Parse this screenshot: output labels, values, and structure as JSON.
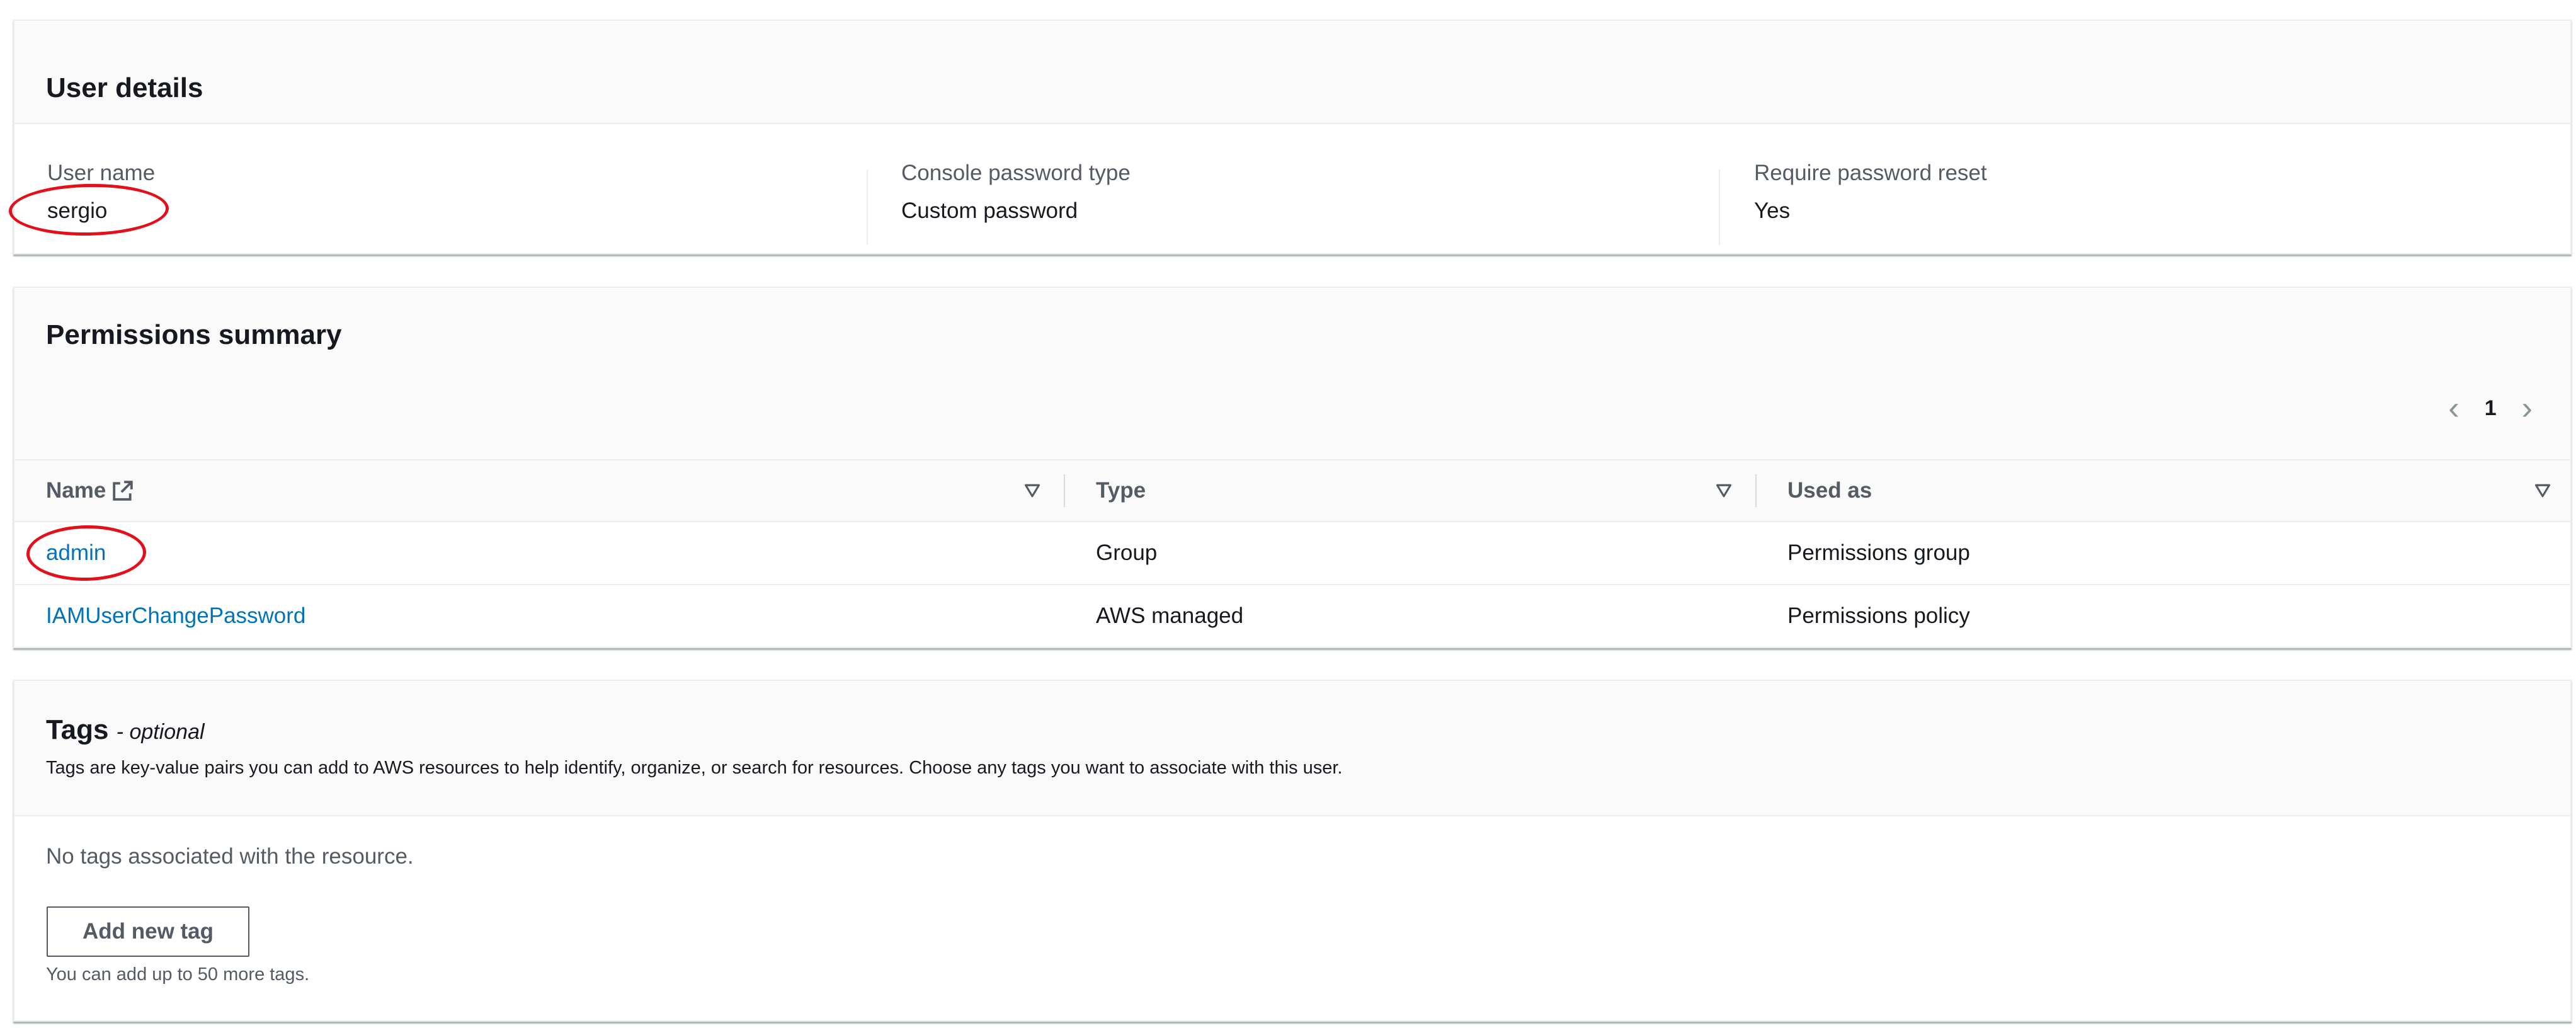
{
  "user_details": {
    "title": "User details",
    "fields": [
      {
        "label": "User name",
        "value": "sergio"
      },
      {
        "label": "Console password type",
        "value": "Custom password"
      },
      {
        "label": "Require password reset",
        "value": "Yes"
      }
    ]
  },
  "permissions": {
    "title": "Permissions summary",
    "pagination": {
      "current_page": "1"
    },
    "columns": [
      "Name",
      "Type",
      "Used as"
    ],
    "rows": [
      {
        "name": "admin",
        "type": "Group",
        "used_as": "Permissions group"
      },
      {
        "name": "IAMUserChangePassword",
        "type": "AWS managed",
        "used_as": "Permissions policy"
      }
    ]
  },
  "tags": {
    "title": "Tags",
    "title_suffix": "- optional",
    "description": "Tags are key-value pairs you can add to AWS resources to help identify, organize, or search for resources. Choose any tags you want to associate with this user.",
    "empty_message": "No tags associated with the resource.",
    "add_button_label": "Add new tag",
    "limit_hint": "You can add up to 50 more tags."
  },
  "icons": {
    "pager_prev": "chevron-left-icon",
    "pager_next": "chevron-right-icon",
    "external_link": "external-link-icon",
    "sort": "sort-caret-down-icon"
  },
  "colors": {
    "link": "#0073bb",
    "annotation": "#e3101b"
  }
}
